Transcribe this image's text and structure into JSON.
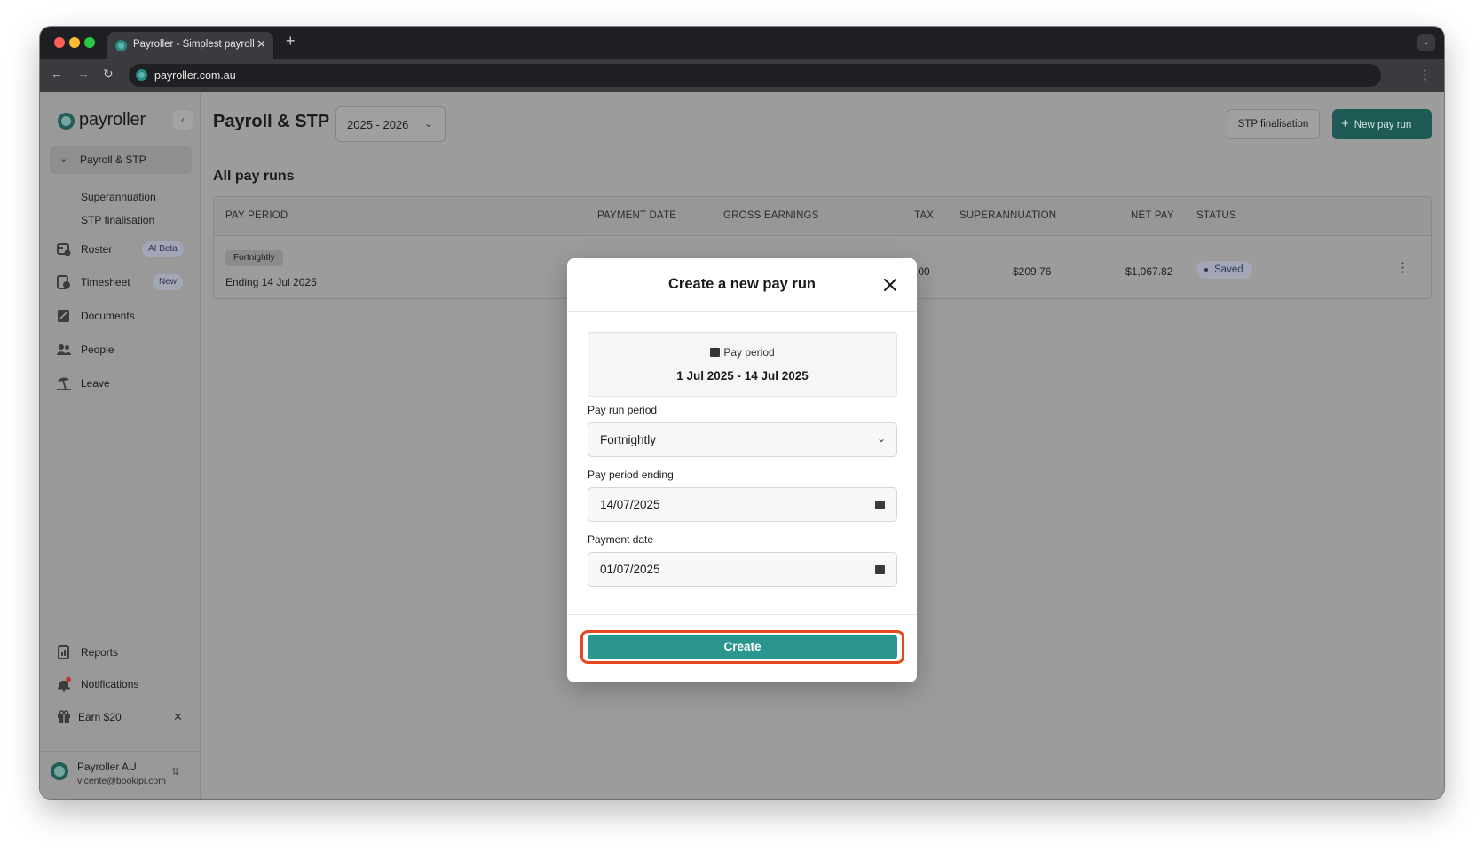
{
  "browser": {
    "tab_title": "Payroller - Simplest payroll software",
    "url": "payroller.com.au"
  },
  "sidebar": {
    "logo_text": "payroller",
    "active_section": "Payroll & STP",
    "subitems": [
      "Superannuation",
      "STP finalisation"
    ],
    "items": [
      {
        "label": "Roster",
        "badge": "AI Beta",
        "icon": "roster-icon"
      },
      {
        "label": "Timesheet",
        "badge": "New",
        "icon": "timesheet-icon"
      },
      {
        "label": "Documents",
        "icon": "documents-icon"
      },
      {
        "label": "People",
        "icon": "people-icon"
      },
      {
        "label": "Leave",
        "icon": "leave-icon"
      }
    ],
    "bottom_items": [
      {
        "label": "Reports",
        "icon": "reports-icon"
      },
      {
        "label": "Notifications",
        "icon": "bell-icon"
      },
      {
        "label": "Earn $20",
        "icon": "gift-icon"
      }
    ],
    "account": {
      "name": "Payroller AU",
      "email": "vicente@bookipi.com"
    }
  },
  "header": {
    "title": "Payroll & STP",
    "year": "2025 - 2026",
    "stp_button": "STP finalisation",
    "new_button": "New pay run"
  },
  "section_title": "All pay runs",
  "table": {
    "columns": [
      "PAY PERIOD",
      "PAYMENT DATE",
      "GROSS EARNINGS",
      "TAX",
      "SUPERANNUATION",
      "NET PAY",
      "STATUS"
    ],
    "row": {
      "frequency": "Fortnightly",
      "ending": "Ending 14 Jul 2025",
      "tax": ".00",
      "super": "$209.76",
      "net": "$1,067.82",
      "status": "Saved"
    }
  },
  "modal": {
    "title": "Create a new pay run",
    "period_label": "Pay period",
    "period_range": "1 Jul 2025 - 14 Jul 2025",
    "run_period_label": "Pay run period",
    "run_period_value": "Fortnightly",
    "ending_label": "Pay period ending",
    "ending_value": "14/07/2025",
    "payment_label": "Payment date",
    "payment_value": "01/07/2025",
    "create_label": "Create"
  },
  "colors": {
    "brand": "#2b968f",
    "brand_dark": "#1e5b56",
    "highlight": "#e84820"
  }
}
